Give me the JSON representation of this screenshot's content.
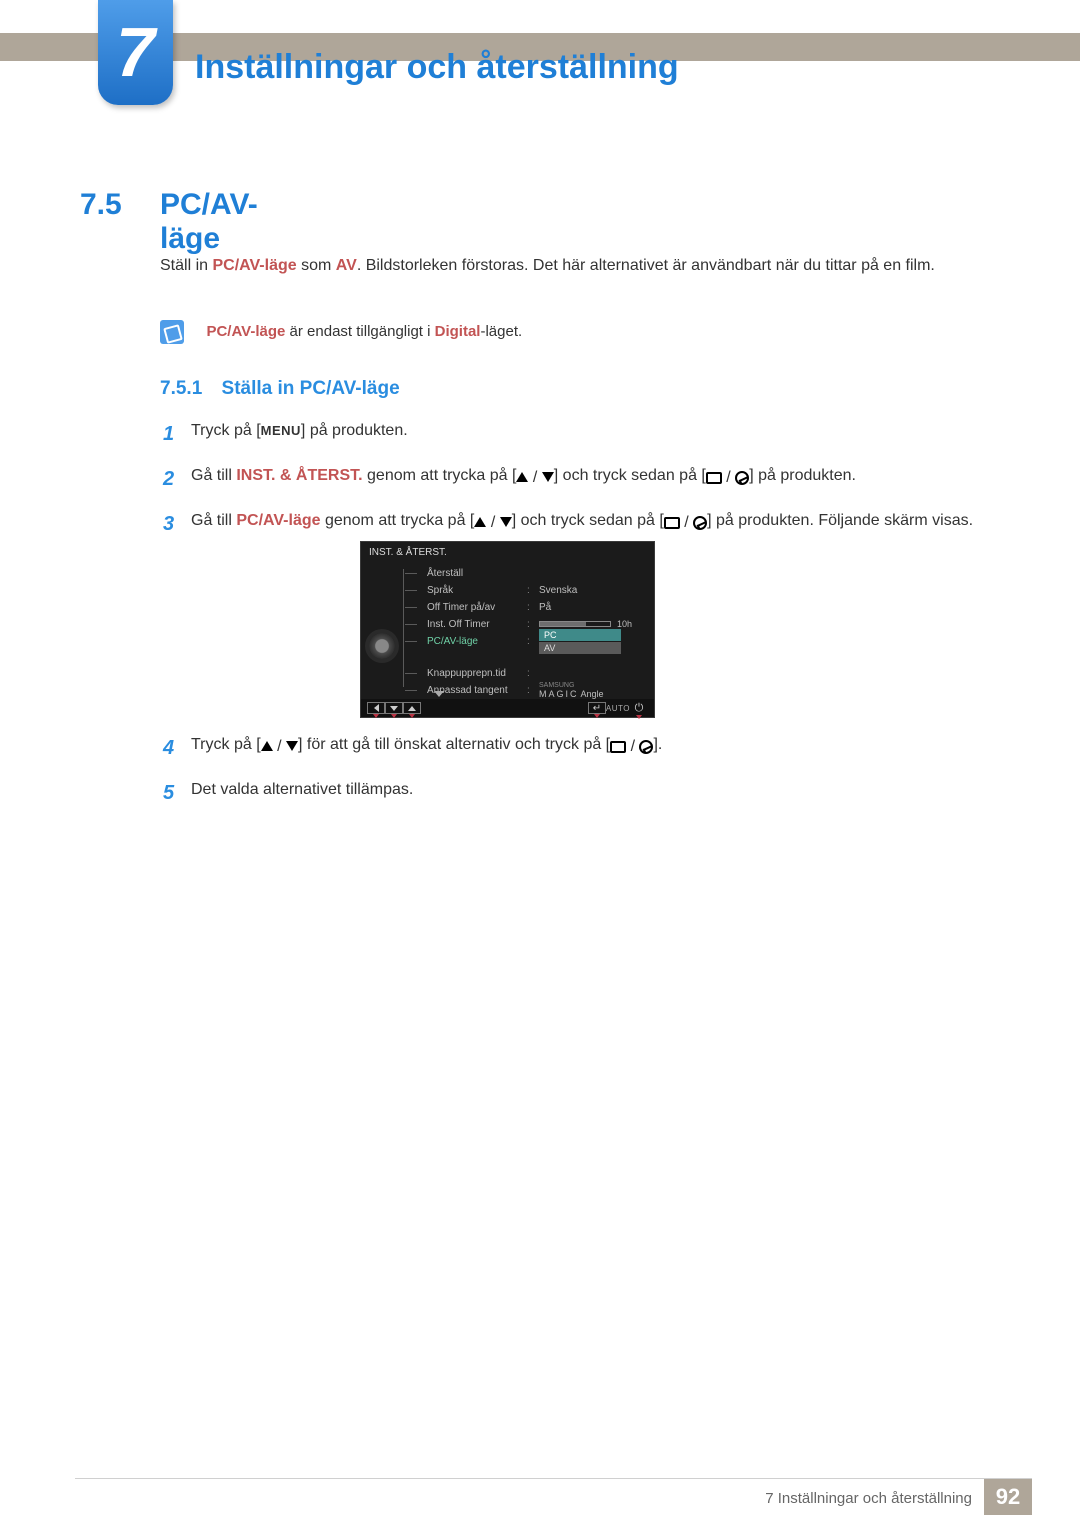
{
  "chapter": {
    "number": "7",
    "title": "Inställningar och återställning"
  },
  "section": {
    "number": "7.5",
    "title": "PC/AV-läge"
  },
  "intro": {
    "pre": "Ställ in ",
    "bold1": "PC/AV-läge",
    "mid": " som ",
    "bold2": "AV",
    "post": ". Bildstorleken förstoras. Det här alternativet är användbart när du tittar på en film."
  },
  "note": {
    "bold1": "PC/AV-läge",
    "mid": " är endast tillgängligt i ",
    "bold2": "Digital",
    "post": "-läget."
  },
  "subsection": {
    "number": "7.5.1",
    "title": "Ställa in PC/AV-läge"
  },
  "steps": {
    "n1": "1",
    "n2": "2",
    "n3": "3",
    "n4": "4",
    "n5": "5",
    "s1a": "Tryck på [",
    "menu": "MENU",
    "s1b": "] på produkten.",
    "s2a": "Gå till ",
    "s2bold": "INST. & ÅTERST.",
    "s2b": " genom att trycka på [",
    "s2c": "] och tryck sedan på [",
    "s2d": "] på produkten.",
    "s3a": "Gå till ",
    "s3bold": "PC/AV-läge",
    "s3b": " genom att trycka på [",
    "s3c": "] och tryck sedan på [",
    "s3d": "] på produkten. Följande skärm visas.",
    "s4a": "Tryck på [",
    "s4b": "] för att gå till önskat alternativ och tryck på [",
    "s4c": "].",
    "s5": "Det valda alternativet tillämpas."
  },
  "osd": {
    "title": "INST. & ÅTERST.",
    "rows": {
      "reset": "Återställ",
      "lang": "Språk",
      "lang_val": "Svenska",
      "offtimer": "Off Timer på/av",
      "offtimer_val": "På",
      "instoff": "Inst. Off Timer",
      "instoff_val": "10h",
      "pcav": "PC/AV-läge",
      "pcav_opt1": "PC",
      "pcav_opt2": "AV",
      "keyrep": "Knappupprepn.tid",
      "custkey": "Anpassad tangent",
      "magic_brand": "SAMSUNG",
      "magic_label": "MAGIC",
      "magic_val": "Angle"
    },
    "footer_auto": "AUTO"
  },
  "footer": {
    "label": "7 Inställningar och återställning",
    "page": "92"
  }
}
